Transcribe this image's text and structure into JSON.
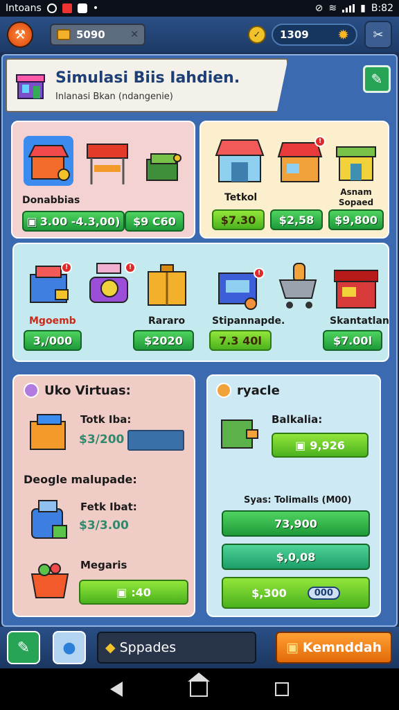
{
  "status_bar": {
    "carrier": "Intoans",
    "time": "B:82"
  },
  "top_bar": {
    "coins": "5090",
    "cash": "1309"
  },
  "header": {
    "title": "Simulasi Biis Iahdien.",
    "subtitle": "Inlanasi Bkan (ndangenie)"
  },
  "panels": {
    "a": {
      "label": "Donabbias",
      "buttons": [
        "3.00 -4.3,00)",
        "$9 C60"
      ]
    },
    "b": {
      "items": [
        {
          "label": "Tetkol"
        },
        {
          "label": ""
        },
        {
          "label": "Asnam Sopaed"
        }
      ],
      "buttons": [
        "$7.30",
        "$2,58",
        "$9,800"
      ]
    },
    "c": {
      "items": [
        {
          "label": "Mgoemb",
          "button": "3,/000"
        },
        {
          "label": ""
        },
        {
          "label": "Rararo",
          "button": "$2020"
        },
        {
          "label": "Stipannapde.",
          "button": "7.3 40l"
        },
        {
          "label": ""
        },
        {
          "label": "Skantatlan",
          "button": "$7.00l"
        }
      ]
    },
    "d": {
      "title": "Uko Virtuas:",
      "stat1_label": "Totk Iba:",
      "stat1_value": "$3/200",
      "section2_title": "Deogle malupade:",
      "stat2_label": "Fetk Ibat:",
      "stat2_value": "$3/3.00",
      "stat3_label": "Megaris",
      "stat3_button": ":40"
    },
    "e": {
      "title": "ryacle",
      "stat1_label": "Balkalia:",
      "stat1_button": "9,926",
      "section2_title": "Syas: Tolimalls (M00)",
      "buttons": [
        "73,900",
        "$,0,08",
        "$,300"
      ],
      "badge": "000"
    }
  },
  "bottom_bar": {
    "upgrade_label": "Sppades",
    "confirm_label": "Kemnddah"
  }
}
